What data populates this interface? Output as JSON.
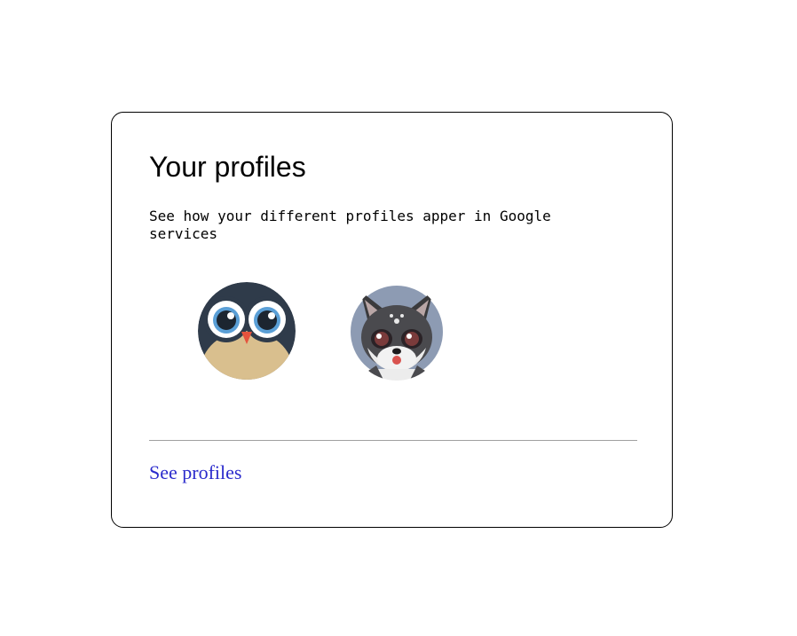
{
  "card": {
    "title": "Your profiles",
    "description": "See how your different profiles apper in Google services",
    "profiles": [
      {
        "name": "owl-avatar",
        "icon": "owl-icon"
      },
      {
        "name": "wolf-avatar",
        "icon": "wolf-icon"
      }
    ],
    "link_label": "See profiles"
  },
  "colors": {
    "link": "#2b2bcc",
    "owl_dark": "#2f3b4a",
    "owl_belly": "#d9bf8e",
    "wolf_bg": "#8d9bb3"
  }
}
